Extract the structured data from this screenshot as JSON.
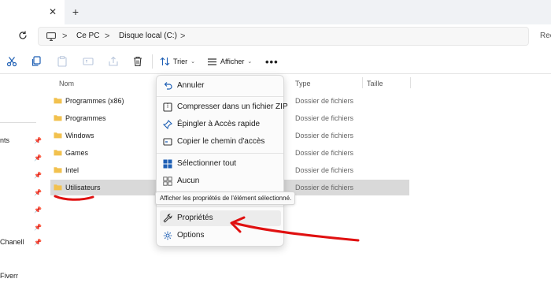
{
  "tabbar": {
    "close_icon": "close-icon",
    "new_tab_icon": "plus-icon",
    "close_glyph": "✕",
    "new_tab_glyph": "+"
  },
  "address": {
    "pc_icon": "computer-icon",
    "crumbs": [
      "Ce PC",
      "Disque local (C:)"
    ],
    "separator": ">",
    "search_text": "Rec"
  },
  "commands": {
    "cut_icon": "scissors-icon",
    "copy_icon": "copy-icon",
    "paste_icon": "clipboard-icon",
    "rename_icon": "rename-icon",
    "share_icon": "share-icon",
    "delete_icon": "trash-icon",
    "sort_label": "Trier",
    "view_label": "Afficher",
    "more_glyph": "•••",
    "chevron": "⌄"
  },
  "nav": {
    "items": [
      {
        "label": "nts",
        "pinned": true
      },
      {
        "label": "Chanell",
        "pinned": true
      },
      {
        "label": "Fiverr",
        "pinned": false
      }
    ]
  },
  "columns": {
    "name": "Nom",
    "type": "Type",
    "size": "Taille"
  },
  "files": [
    {
      "name": "Programmes (x86)",
      "type": "Dossier de fichiers",
      "selected": false
    },
    {
      "name": "Programmes",
      "type": "Dossier de fichiers",
      "selected": false
    },
    {
      "name": "Windows",
      "type": "Dossier de fichiers",
      "selected": false
    },
    {
      "name": "Games",
      "type": "Dossier de fichiers",
      "selected": false
    },
    {
      "name": "Intel",
      "type": "Dossier de fichiers",
      "selected": false
    },
    {
      "name": "Utilisateurs",
      "type": "Dossier de fichiers",
      "selected": true
    }
  ],
  "context_menu": {
    "undo": "Annuler",
    "compress": "Compresser dans un fichier ZIP",
    "pin_quick": "Épingler à Accès rapide",
    "copy_path": "Copier le chemin d'accès",
    "select_all": "Sélectionner tout",
    "none": "Aucun",
    "properties": "Propriétés",
    "options": "Options"
  },
  "tooltip": "Afficher les propriétés de l'élément sélectionné.",
  "colors": {
    "folder": "#f2c14e",
    "accent": "#1e5fb4",
    "annotation": "#e01010"
  }
}
